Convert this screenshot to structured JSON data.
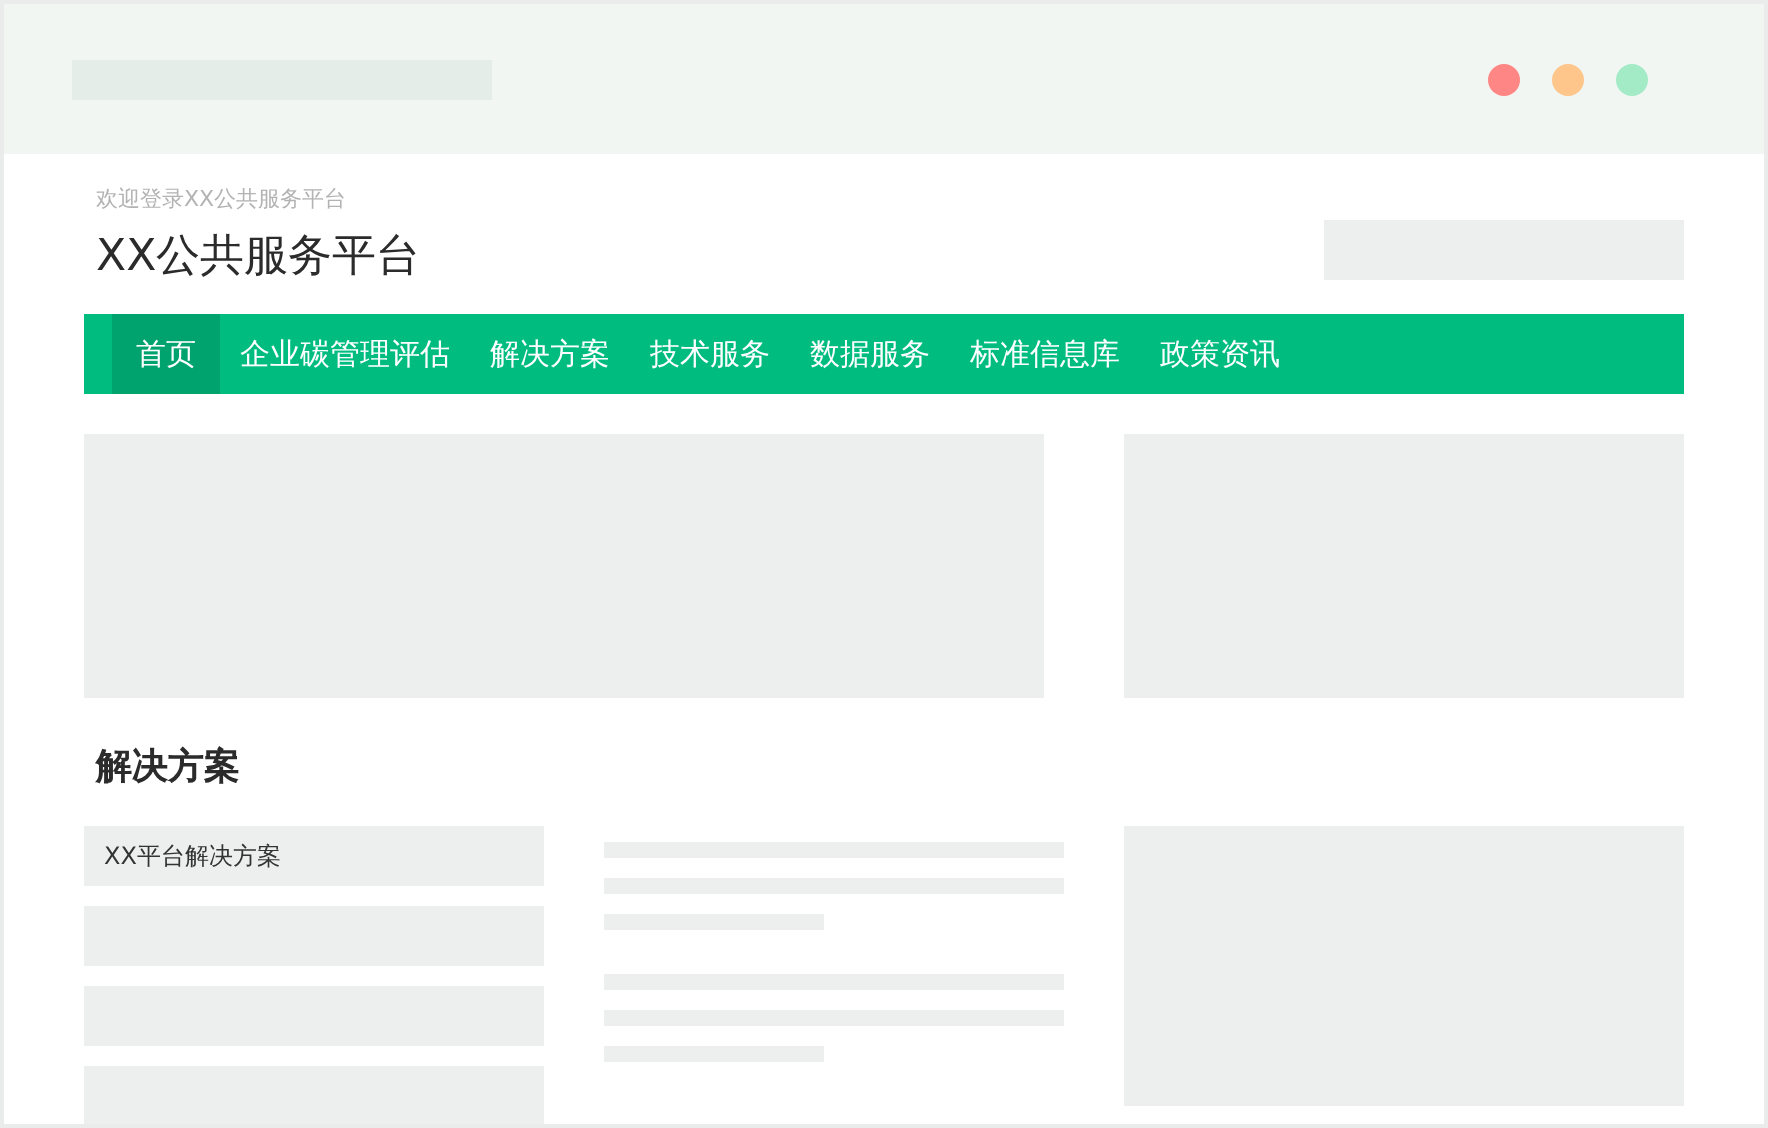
{
  "header": {
    "welcome": "欢迎登录XX公共服务平台",
    "site_title": "XX公共服务平台"
  },
  "nav": [
    {
      "label": "首页",
      "selected": true
    },
    {
      "label": "企业碳管理评估",
      "selected": false
    },
    {
      "label": "解决方案",
      "selected": false
    },
    {
      "label": "技术服务",
      "selected": false
    },
    {
      "label": "数据服务",
      "selected": false
    },
    {
      "label": "标准信息库",
      "selected": false
    },
    {
      "label": "政策资讯",
      "selected": false
    }
  ],
  "solutions": {
    "heading": "解决方案",
    "items": [
      {
        "label": "XX平台解决方案"
      }
    ]
  }
}
